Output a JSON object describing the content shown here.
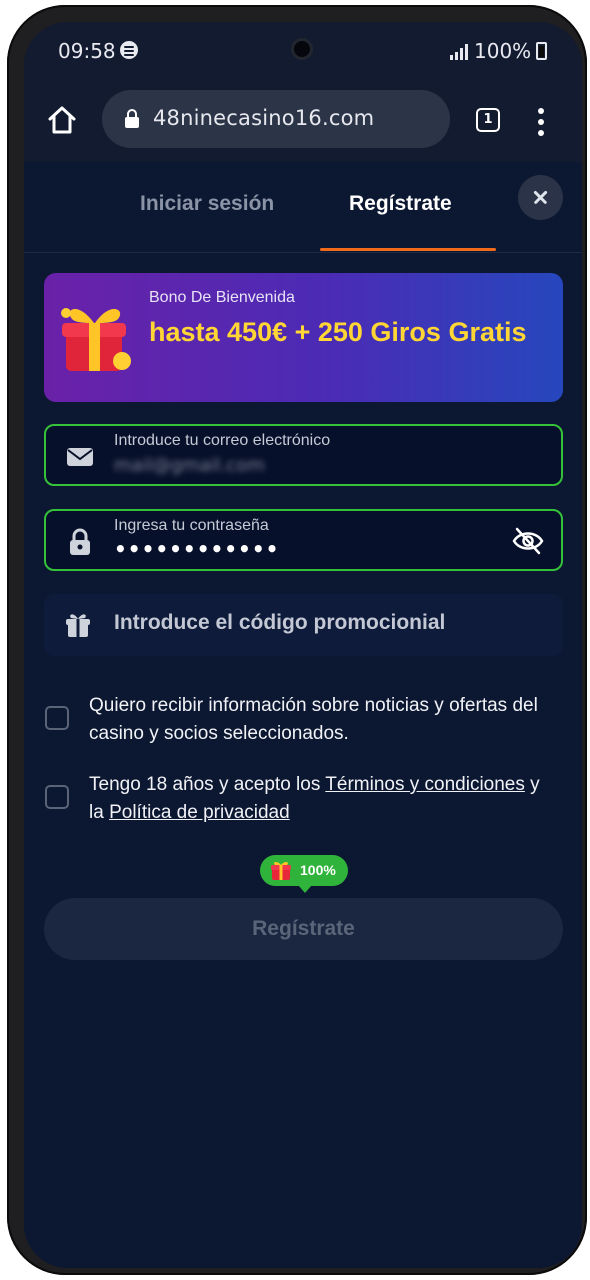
{
  "status_bar": {
    "time": "09:58",
    "battery": "100%"
  },
  "browser": {
    "url": "48ninecasino16.com",
    "tab_count": "1"
  },
  "auth_tabs": {
    "login": "Iniciar sesión",
    "register": "Regístrate"
  },
  "bonus": {
    "label": "Bono De Bienvenida",
    "title": "hasta 450€ + 250 Giros Gratis"
  },
  "form": {
    "email_label": "Introduce tu correo electrónico",
    "email_value": "mail@gmail.com",
    "password_label": "Ingresa tu contraseña",
    "password_value": "••••••••••••",
    "promo_placeholder": "Introduce el código promocionial"
  },
  "checks": {
    "news": "Quiero recibir información sobre noticias y ofertas del casino y socios seleccionados.",
    "age_prefix": "Tengo 18 años y acepto los ",
    "terms_link": "Términos y condiciones",
    "age_middle": " y la ",
    "privacy_link": "Política de privacidad"
  },
  "progress_badge": "100%",
  "submit_label": "Regístrate",
  "colors": {
    "background": "#0c1731",
    "accent_tab": "#f26a1b",
    "valid_border": "#35c13a",
    "bonus_text": "#ffd633",
    "badge": "#2fb33a"
  }
}
